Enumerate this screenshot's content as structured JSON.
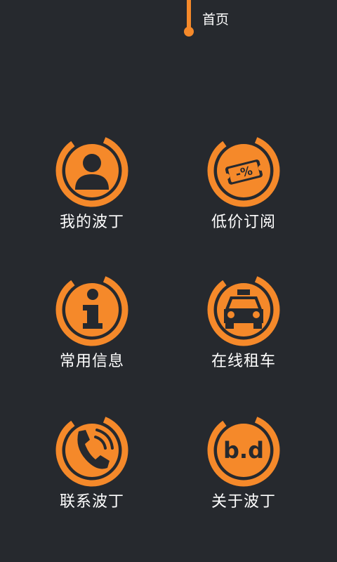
{
  "header": {
    "home_label": "首页"
  },
  "colors": {
    "background": "#26292e",
    "accent": "#f5892a",
    "icon_fill": "#26292e"
  },
  "menu": {
    "items": [
      {
        "label": "我的波丁",
        "icon": "user-icon"
      },
      {
        "label": "低价订阅",
        "icon": "coupon-icon"
      },
      {
        "label": "常用信息",
        "icon": "info-icon"
      },
      {
        "label": "在线租车",
        "icon": "taxi-icon"
      },
      {
        "label": "联系波丁",
        "icon": "phone-icon"
      },
      {
        "label": "关于波丁",
        "icon": "logo-icon"
      }
    ],
    "coupon_text": "-%",
    "logo_text": "b.d"
  }
}
